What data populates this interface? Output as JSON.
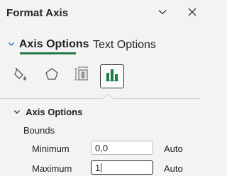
{
  "header": {
    "title": "Format Axis",
    "collapse_icon": "chevron-down-icon",
    "close_icon": "close-icon"
  },
  "tabs": [
    {
      "label": "Axis Options",
      "active": true
    },
    {
      "label": "Text Options",
      "active": false
    }
  ],
  "icon_tabs": [
    {
      "icon": "fill-line-icon",
      "active": false
    },
    {
      "icon": "effects-pentagon-icon",
      "active": false
    },
    {
      "icon": "size-properties-icon",
      "active": false
    },
    {
      "icon": "axis-options-bar-icon",
      "active": true
    }
  ],
  "section": {
    "title": "Axis Options",
    "bounds_label": "Bounds",
    "minimum": {
      "label": "Minimum",
      "value": "0,0",
      "auto": "Auto"
    },
    "maximum": {
      "label": "Maximum",
      "value": "1",
      "auto": "Auto"
    }
  },
  "colors": {
    "accent": "#1f7a45",
    "background": "#f3f3f3",
    "active_bars": "#1f7a45"
  }
}
